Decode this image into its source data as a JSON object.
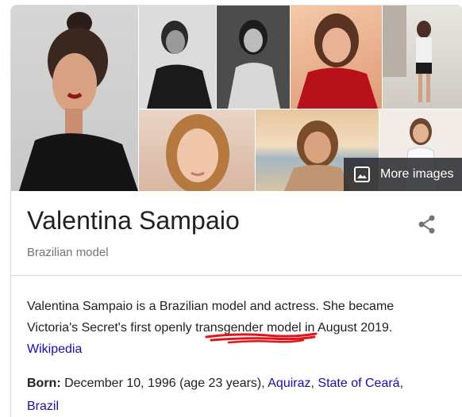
{
  "images": {
    "more_images_label": "More images",
    "tiles": [
      {
        "name": "image-main-portrait",
        "tone": "dark"
      },
      {
        "name": "image-bw-1",
        "tone": "bw"
      },
      {
        "name": "image-bw-2",
        "tone": "bw"
      },
      {
        "name": "image-red-jacket",
        "tone": "warm"
      },
      {
        "name": "image-street",
        "tone": "light"
      },
      {
        "name": "image-closeup",
        "tone": "warm"
      },
      {
        "name": "image-beach",
        "tone": "sun"
      },
      {
        "name": "image-white-top",
        "tone": "light"
      }
    ]
  },
  "entity": {
    "name": "Valentina Sampaio",
    "subtitle": "Brazilian model",
    "share_icon": "share-icon"
  },
  "description": {
    "text_before": "Valentina Sampaio is a Brazilian model and actress. She became Victoria's Secret's first openly ",
    "highlight": "transgender model",
    "text_after": " in August 2019.",
    "source_link": "Wikipedia"
  },
  "born": {
    "label": "Born:",
    "value": " December 10, 1996 (age 23 years), ",
    "place_1": "Aquiraz",
    "sep": ", ",
    "place_2": "State of Ceará",
    "sep2": ",",
    "place_3": "Brazil"
  },
  "colors": {
    "link": "#1a0dab",
    "title": "#202124",
    "subtitle": "#70757a",
    "scribble": "#e0141b"
  }
}
